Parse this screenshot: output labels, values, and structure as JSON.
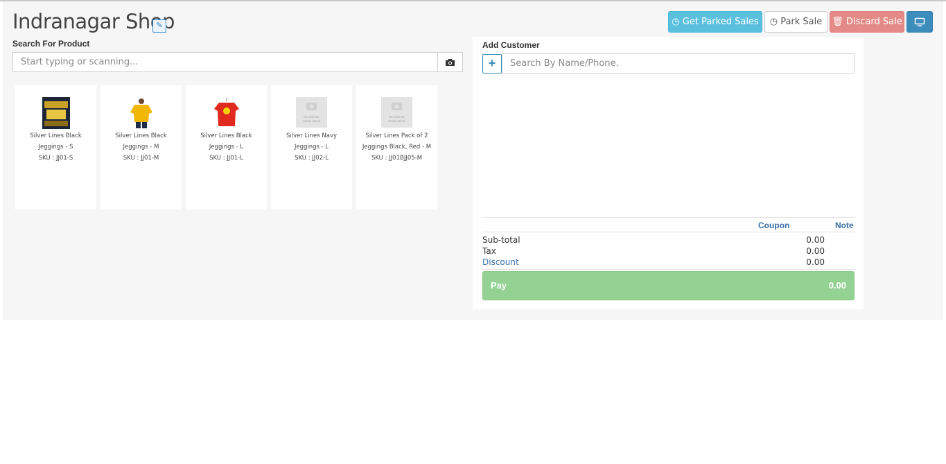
{
  "header": {
    "title": "Indranagar Shop",
    "buttons": {
      "get_parked": "Get Parked Sales",
      "park": "Park Sale",
      "discard": "Discard Sale"
    }
  },
  "product_search": {
    "label": "Search For Product",
    "placeholder": "Start typing or scanning..."
  },
  "products": [
    {
      "name": "Silver Lines Black Jeggings - S",
      "sku": "SKU : JJ01-S",
      "image": "poster-2019"
    },
    {
      "name": "Silver Lines Black Jeggings - M",
      "sku": "SKU : JJ01-M",
      "image": "yellow-tshirt"
    },
    {
      "name": "Silver Lines Black Jeggings - L",
      "sku": "SKU : JJ01-L",
      "image": "red-tshirt"
    },
    {
      "name": "Silver Lines Navy Jeggings - L",
      "sku": "SKU : JJ02-L",
      "image": "no-image"
    },
    {
      "name": "Silver Lines Pack of 2 Jeggings Black, Red - M",
      "sku": "SKU : JJ01BJJ05-M",
      "image": "no-image"
    }
  ],
  "no_image_text": "NO IMAGE AVAILABLE",
  "customer": {
    "label": "Add Customer",
    "placeholder": "Search By Name/Phone."
  },
  "cart": {
    "coupon": "Coupon",
    "note": "Note",
    "subtotal_label": "Sub-total",
    "subtotal": "0.00",
    "tax_label": "Tax",
    "tax": "0.00",
    "discount_label": "Discount",
    "discount": "0.00",
    "pay_label": "Pay",
    "pay_total": "0.00"
  },
  "colors": {
    "info": "#5bc0de",
    "danger_muted": "#e48a87",
    "primary": "#3c8dbc",
    "success_muted": "#93d293",
    "link": "#3a6fa8"
  }
}
